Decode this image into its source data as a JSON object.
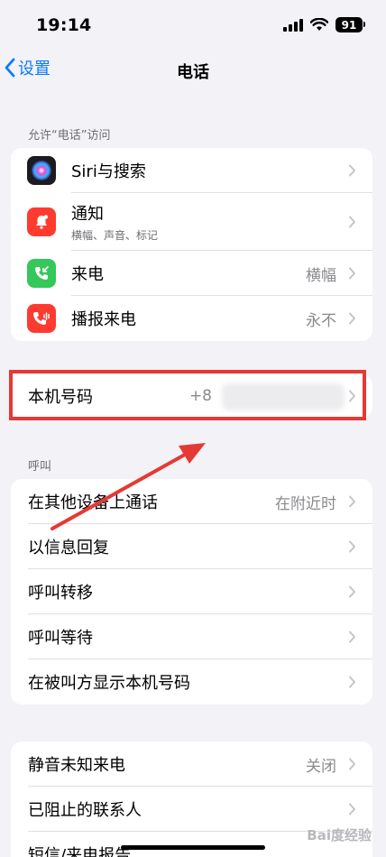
{
  "status_bar": {
    "time": "19:14",
    "battery": "91"
  },
  "nav": {
    "back_label": "设置",
    "title": "电话"
  },
  "section_access": {
    "header": "允许“电话”访问",
    "rows": [
      {
        "label": "Siri与搜索",
        "value": "",
        "subtitle": ""
      },
      {
        "label": "通知",
        "value": "",
        "subtitle": "横幅、声音、标记"
      },
      {
        "label": "来电",
        "value": "横幅",
        "subtitle": ""
      },
      {
        "label": "播报来电",
        "value": "永不",
        "subtitle": ""
      }
    ]
  },
  "my_number": {
    "label": "本机号码",
    "value": "+8"
  },
  "section_calls": {
    "header": "呼叫",
    "rows": [
      {
        "label": "在其他设备上通话",
        "value": "在附近时"
      },
      {
        "label": "以信息回复",
        "value": ""
      },
      {
        "label": "呼叫转移",
        "value": ""
      },
      {
        "label": "呼叫等待",
        "value": ""
      },
      {
        "label": "在被叫方显示本机号码",
        "value": ""
      }
    ]
  },
  "section_block": {
    "rows": [
      {
        "label": "静音未知来电",
        "value": "关闭"
      },
      {
        "label": "已阻止的联系人",
        "value": ""
      },
      {
        "label": "短信/来电报告",
        "value": ""
      }
    ]
  },
  "watermark": "Bai度经验",
  "colors": {
    "accent": "#0a7aff",
    "annotation": "#e53935"
  }
}
